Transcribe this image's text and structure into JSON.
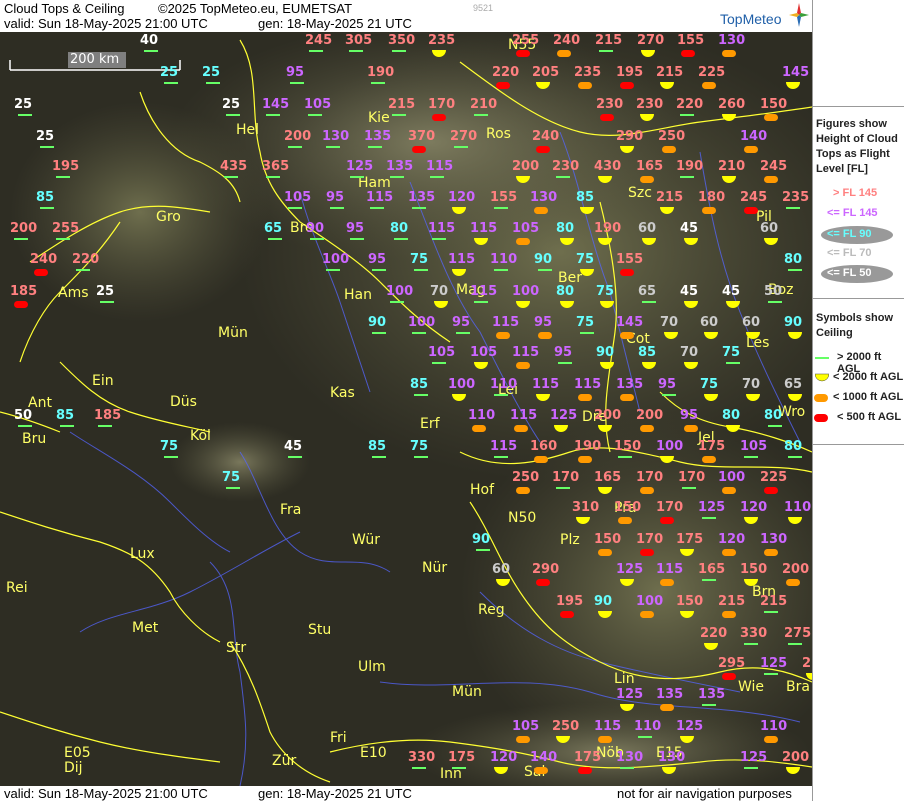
{
  "header": {
    "product": "Cloud Tops & Ceiling",
    "copyright": "©2025 TopMeteo.eu, EUMETSAT",
    "valid": "valid:  Sun  18-May-2025  21:00 UTC",
    "generated": "gen: 18-May-2025 21 UTC",
    "image_id": "9521",
    "logo": "TopMeteo"
  },
  "footer": {
    "valid": "valid:  Sun  18-May-2025  21:00 UTC",
    "generated": "gen: 18-May-2025 21 UTC",
    "note": "not for air navigation purposes"
  },
  "scale": "200 km",
  "legend": {
    "tops_title": "Figures show Height of Cloud Tops as Flight Level  [FL]",
    "tops": [
      {
        "label": "> FL 145",
        "color": "#ff8080"
      },
      {
        "label": "<= FL 145",
        "color": "#cc66ff"
      },
      {
        "label": "<= FL 90",
        "color": "#66ffff"
      },
      {
        "label": "<= FL 70",
        "color": "#cccccc"
      },
      {
        "label": "<= FL 50",
        "color": "#ffffff"
      }
    ],
    "ceiling_title": "Symbols show Ceiling",
    "ceiling": [
      {
        "label": "> 2000 ft AGL",
        "color": "#66ff66",
        "symbol": "line"
      },
      {
        "label": "< 2000 ft AGL",
        "color": "#ffff00",
        "symbol": "half-circle"
      },
      {
        "label": "< 1000 ft AGL",
        "color": "#ff9900",
        "symbol": "pill"
      },
      {
        "label": "< 500 ft AGL",
        "color": "#ff0000",
        "symbol": "pill"
      }
    ]
  },
  "cities": [
    {
      "name": "Hel"
    },
    {
      "name": "Kie"
    },
    {
      "name": "Ros"
    },
    {
      "name": "Szc"
    },
    {
      "name": "Ham"
    },
    {
      "name": "Bre"
    },
    {
      "name": "Gro"
    },
    {
      "name": "Pil"
    },
    {
      "name": "Ams"
    },
    {
      "name": "Han"
    },
    {
      "name": "Ber"
    },
    {
      "name": "Boz"
    },
    {
      "name": "Mün"
    },
    {
      "name": "Mag"
    },
    {
      "name": "Lei"
    },
    {
      "name": "Cot"
    },
    {
      "name": "Les"
    },
    {
      "name": "Ein"
    },
    {
      "name": "Ant"
    },
    {
      "name": "Bru"
    },
    {
      "name": "Düs"
    },
    {
      "name": "Köl"
    },
    {
      "name": "Kas"
    },
    {
      "name": "Erf"
    },
    {
      "name": "Dre"
    },
    {
      "name": "Jel"
    },
    {
      "name": "Wro"
    },
    {
      "name": "Hof"
    },
    {
      "name": "N50"
    },
    {
      "name": "Fra"
    },
    {
      "name": "Pra"
    },
    {
      "name": "Lux"
    },
    {
      "name": "Wür"
    },
    {
      "name": "Plz"
    },
    {
      "name": "Rei"
    },
    {
      "name": "Met"
    },
    {
      "name": "Nür"
    },
    {
      "name": "Brn"
    },
    {
      "name": "Reg"
    },
    {
      "name": "Stu"
    },
    {
      "name": "Str"
    },
    {
      "name": "Ulm"
    },
    {
      "name": "Lin"
    },
    {
      "name": "Wie"
    },
    {
      "name": "Bra"
    },
    {
      "name": "Mün"
    },
    {
      "name": "Fri"
    },
    {
      "name": "E10"
    },
    {
      "name": "E05"
    },
    {
      "name": "Dij"
    },
    {
      "name": "Zür"
    },
    {
      "name": "Inn"
    },
    {
      "name": "Sal"
    },
    {
      "name": "Nöb"
    },
    {
      "name": "E15"
    },
    {
      "name": "N55"
    }
  ],
  "tops": [
    {
      "v": "40",
      "c": "w"
    },
    {
      "v": "245",
      "c": "r"
    },
    {
      "v": "305",
      "c": "r"
    },
    {
      "v": "350",
      "c": "r"
    },
    {
      "v": "235",
      "c": "r"
    },
    {
      "v": "255",
      "c": "r"
    },
    {
      "v": "240",
      "c": "r"
    },
    {
      "v": "215",
      "c": "r"
    },
    {
      "v": "270",
      "c": "r"
    },
    {
      "v": "155",
      "c": "r"
    },
    {
      "v": "130",
      "c": "p"
    },
    {
      "v": "25",
      "c": "c"
    },
    {
      "v": "25",
      "c": "c"
    },
    {
      "v": "95",
      "c": "p"
    },
    {
      "v": "190",
      "c": "r"
    },
    {
      "v": "220",
      "c": "r"
    },
    {
      "v": "205",
      "c": "r"
    },
    {
      "v": "235",
      "c": "r"
    },
    {
      "v": "195",
      "c": "r"
    },
    {
      "v": "215",
      "c": "r"
    },
    {
      "v": "225",
      "c": "r"
    },
    {
      "v": "145",
      "c": "p"
    },
    {
      "v": "25",
      "c": "w"
    },
    {
      "v": "25",
      "c": "w"
    },
    {
      "v": "145",
      "c": "p"
    },
    {
      "v": "105",
      "c": "p"
    },
    {
      "v": "215",
      "c": "r"
    },
    {
      "v": "170",
      "c": "r"
    },
    {
      "v": "210",
      "c": "r"
    },
    {
      "v": "230",
      "c": "r"
    },
    {
      "v": "230",
      "c": "r"
    },
    {
      "v": "220",
      "c": "r"
    },
    {
      "v": "260",
      "c": "r"
    },
    {
      "v": "150",
      "c": "r"
    },
    {
      "v": "25",
      "c": "w"
    },
    {
      "v": "200",
      "c": "r"
    },
    {
      "v": "130",
      "c": "p"
    },
    {
      "v": "135",
      "c": "p"
    },
    {
      "v": "370",
      "c": "r"
    },
    {
      "v": "270",
      "c": "r"
    },
    {
      "v": "240",
      "c": "r"
    },
    {
      "v": "290",
      "c": "r"
    },
    {
      "v": "250",
      "c": "r"
    },
    {
      "v": "140",
      "c": "p"
    },
    {
      "v": "195",
      "c": "r"
    },
    {
      "v": "435",
      "c": "r"
    },
    {
      "v": "365",
      "c": "r"
    },
    {
      "v": "125",
      "c": "p"
    },
    {
      "v": "135",
      "c": "p"
    },
    {
      "v": "115",
      "c": "p"
    },
    {
      "v": "200",
      "c": "r"
    },
    {
      "v": "230",
      "c": "r"
    },
    {
      "v": "430",
      "c": "r"
    },
    {
      "v": "165",
      "c": "r"
    },
    {
      "v": "190",
      "c": "r"
    },
    {
      "v": "210",
      "c": "r"
    },
    {
      "v": "245",
      "c": "r"
    },
    {
      "v": "85",
      "c": "c"
    },
    {
      "v": "105",
      "c": "p"
    },
    {
      "v": "95",
      "c": "p"
    },
    {
      "v": "115",
      "c": "p"
    },
    {
      "v": "135",
      "c": "p"
    },
    {
      "v": "120",
      "c": "p"
    },
    {
      "v": "155",
      "c": "r"
    },
    {
      "v": "130",
      "c": "p"
    },
    {
      "v": "85",
      "c": "c"
    },
    {
      "v": "215",
      "c": "r"
    },
    {
      "v": "180",
      "c": "r"
    },
    {
      "v": "245",
      "c": "r"
    },
    {
      "v": "235",
      "c": "r"
    },
    {
      "v": "200",
      "c": "r"
    },
    {
      "v": "255",
      "c": "r"
    },
    {
      "v": "65",
      "c": "c"
    },
    {
      "v": "90",
      "c": "p"
    },
    {
      "v": "95",
      "c": "p"
    },
    {
      "v": "80",
      "c": "c"
    },
    {
      "v": "115",
      "c": "p"
    },
    {
      "v": "115",
      "c": "p"
    },
    {
      "v": "105",
      "c": "p"
    },
    {
      "v": "80",
      "c": "c"
    },
    {
      "v": "190",
      "c": "r"
    },
    {
      "v": "60",
      "c": "g"
    },
    {
      "v": "45",
      "c": "w"
    },
    {
      "v": "60",
      "c": "g"
    },
    {
      "v": "240",
      "c": "r"
    },
    {
      "v": "220",
      "c": "r"
    },
    {
      "v": "100",
      "c": "p"
    },
    {
      "v": "95",
      "c": "p"
    },
    {
      "v": "75",
      "c": "c"
    },
    {
      "v": "115",
      "c": "p"
    },
    {
      "v": "110",
      "c": "p"
    },
    {
      "v": "90",
      "c": "c"
    },
    {
      "v": "75",
      "c": "c"
    },
    {
      "v": "155",
      "c": "r"
    },
    {
      "v": "80",
      "c": "c"
    },
    {
      "v": "185",
      "c": "r"
    },
    {
      "v": "25",
      "c": "w"
    },
    {
      "v": "100",
      "c": "p"
    },
    {
      "v": "70",
      "c": "g"
    },
    {
      "v": "115",
      "c": "p"
    },
    {
      "v": "100",
      "c": "p"
    },
    {
      "v": "80",
      "c": "c"
    },
    {
      "v": "75",
      "c": "c"
    },
    {
      "v": "65",
      "c": "g"
    },
    {
      "v": "45",
      "c": "w"
    },
    {
      "v": "45",
      "c": "w"
    },
    {
      "v": "50",
      "c": "g"
    },
    {
      "v": "90",
      "c": "c"
    },
    {
      "v": "100",
      "c": "p"
    },
    {
      "v": "95",
      "c": "p"
    },
    {
      "v": "115",
      "c": "p"
    },
    {
      "v": "95",
      "c": "p"
    },
    {
      "v": "75",
      "c": "c"
    },
    {
      "v": "145",
      "c": "p"
    },
    {
      "v": "70",
      "c": "g"
    },
    {
      "v": "60",
      "c": "g"
    },
    {
      "v": "60",
      "c": "g"
    },
    {
      "v": "90",
      "c": "c"
    },
    {
      "v": "105",
      "c": "p"
    },
    {
      "v": "105",
      "c": "p"
    },
    {
      "v": "115",
      "c": "p"
    },
    {
      "v": "95",
      "c": "p"
    },
    {
      "v": "90",
      "c": "c"
    },
    {
      "v": "85",
      "c": "c"
    },
    {
      "v": "70",
      "c": "g"
    },
    {
      "v": "75",
      "c": "c"
    },
    {
      "v": "85",
      "c": "c"
    },
    {
      "v": "100",
      "c": "p"
    },
    {
      "v": "110",
      "c": "p"
    },
    {
      "v": "115",
      "c": "p"
    },
    {
      "v": "115",
      "c": "p"
    },
    {
      "v": "135",
      "c": "p"
    },
    {
      "v": "95",
      "c": "p"
    },
    {
      "v": "75",
      "c": "c"
    },
    {
      "v": "70",
      "c": "g"
    },
    {
      "v": "65",
      "c": "g"
    },
    {
      "v": "50",
      "c": "w"
    },
    {
      "v": "85",
      "c": "c"
    },
    {
      "v": "185",
      "c": "r"
    },
    {
      "v": "110",
      "c": "p"
    },
    {
      "v": "115",
      "c": "p"
    },
    {
      "v": "125",
      "c": "p"
    },
    {
      "v": "200",
      "c": "r"
    },
    {
      "v": "200",
      "c": "r"
    },
    {
      "v": "95",
      "c": "p"
    },
    {
      "v": "80",
      "c": "c"
    },
    {
      "v": "80",
      "c": "c"
    },
    {
      "v": "75",
      "c": "c"
    },
    {
      "v": "45",
      "c": "w"
    },
    {
      "v": "85",
      "c": "c"
    },
    {
      "v": "75",
      "c": "c"
    },
    {
      "v": "115",
      "c": "p"
    },
    {
      "v": "160",
      "c": "r"
    },
    {
      "v": "190",
      "c": "r"
    },
    {
      "v": "150",
      "c": "r"
    },
    {
      "v": "100",
      "c": "p"
    },
    {
      "v": "175",
      "c": "r"
    },
    {
      "v": "105",
      "c": "p"
    },
    {
      "v": "80",
      "c": "c"
    },
    {
      "v": "75",
      "c": "c"
    },
    {
      "v": "250",
      "c": "r"
    },
    {
      "v": "170",
      "c": "r"
    },
    {
      "v": "165",
      "c": "r"
    },
    {
      "v": "170",
      "c": "r"
    },
    {
      "v": "170",
      "c": "r"
    },
    {
      "v": "100",
      "c": "p"
    },
    {
      "v": "225",
      "c": "r"
    },
    {
      "v": "310",
      "c": "r"
    },
    {
      "v": "150",
      "c": "r"
    },
    {
      "v": "170",
      "c": "r"
    },
    {
      "v": "125",
      "c": "p"
    },
    {
      "v": "120",
      "c": "p"
    },
    {
      "v": "110",
      "c": "p"
    },
    {
      "v": "90",
      "c": "c"
    },
    {
      "v": "150",
      "c": "r"
    },
    {
      "v": "170",
      "c": "r"
    },
    {
      "v": "175",
      "c": "r"
    },
    {
      "v": "120",
      "c": "p"
    },
    {
      "v": "130",
      "c": "p"
    },
    {
      "v": "60",
      "c": "g"
    },
    {
      "v": "290",
      "c": "r"
    },
    {
      "v": "125",
      "c": "p"
    },
    {
      "v": "115",
      "c": "p"
    },
    {
      "v": "165",
      "c": "r"
    },
    {
      "v": "150",
      "c": "r"
    },
    {
      "v": "200",
      "c": "r"
    },
    {
      "v": "195",
      "c": "r"
    },
    {
      "v": "90",
      "c": "c"
    },
    {
      "v": "100",
      "c": "p"
    },
    {
      "v": "150",
      "c": "r"
    },
    {
      "v": "215",
      "c": "r"
    },
    {
      "v": "215",
      "c": "r"
    },
    {
      "v": "220",
      "c": "r"
    },
    {
      "v": "330",
      "c": "r"
    },
    {
      "v": "275",
      "c": "r"
    },
    {
      "v": "295",
      "c": "r"
    },
    {
      "v": "125",
      "c": "p"
    },
    {
      "v": "225",
      "c": "r"
    },
    {
      "v": "125",
      "c": "p"
    },
    {
      "v": "135",
      "c": "p"
    },
    {
      "v": "135",
      "c": "p"
    },
    {
      "v": "105",
      "c": "p"
    },
    {
      "v": "250",
      "c": "r"
    },
    {
      "v": "115",
      "c": "p"
    },
    {
      "v": "110",
      "c": "p"
    },
    {
      "v": "125",
      "c": "p"
    },
    {
      "v": "110",
      "c": "p"
    },
    {
      "v": "330",
      "c": "r"
    },
    {
      "v": "175",
      "c": "r"
    },
    {
      "v": "120",
      "c": "p"
    },
    {
      "v": "140",
      "c": "p"
    },
    {
      "v": "175",
      "c": "r"
    },
    {
      "v": "130",
      "c": "p"
    },
    {
      "v": "125",
      "c": "p"
    },
    {
      "v": "200",
      "c": "r"
    },
    {
      "v": "130",
      "c": "p"
    }
  ]
}
